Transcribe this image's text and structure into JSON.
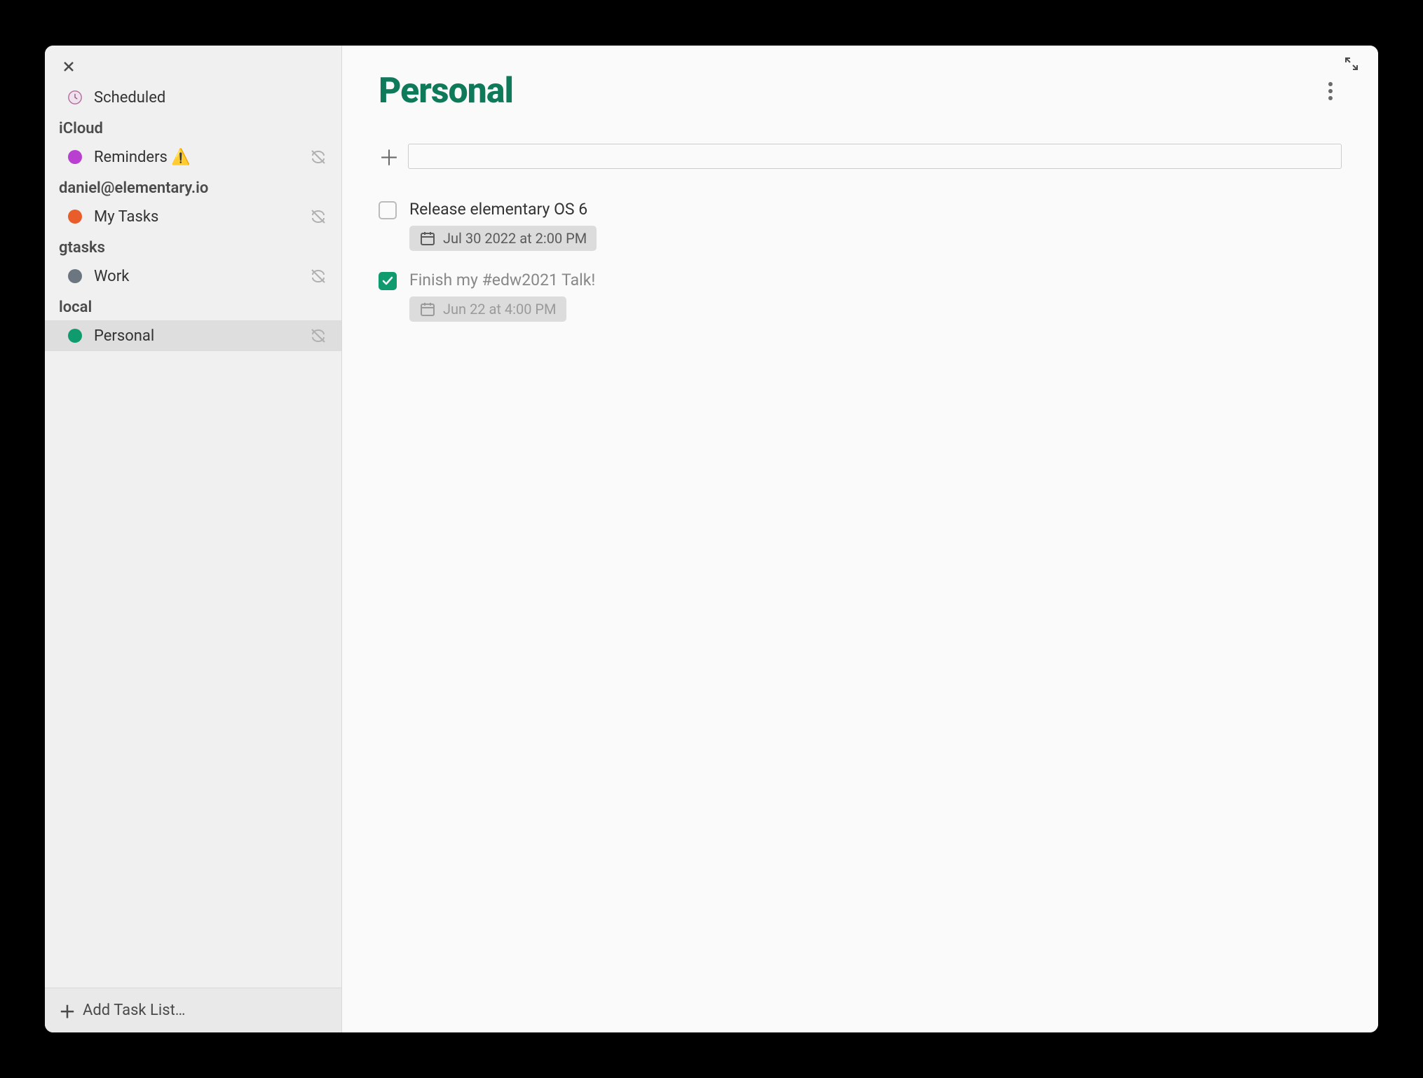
{
  "sidebar": {
    "scheduled_label": "Scheduled",
    "add_task_list_label": "Add Task List…",
    "sections": [
      {
        "name": "iCloud",
        "items": [
          {
            "id": "reminders",
            "label": "Reminders",
            "warning": "⚠️",
            "color": "#b93fd1",
            "has_sync_off": true,
            "selected": false
          }
        ]
      },
      {
        "name": "daniel@elementary.io",
        "items": [
          {
            "id": "my-tasks",
            "label": "My Tasks",
            "color": "#e85d2a",
            "has_sync_off": true,
            "selected": false
          }
        ]
      },
      {
        "name": "gtasks",
        "items": [
          {
            "id": "work",
            "label": "Work",
            "color": "#6b7680",
            "has_sync_off": true,
            "selected": false
          }
        ]
      },
      {
        "name": "local",
        "items": [
          {
            "id": "personal",
            "label": "Personal",
            "color": "#0f9b6e",
            "has_sync_off": true,
            "selected": true
          }
        ]
      }
    ]
  },
  "main": {
    "title": "Personal",
    "title_color": "#0f7a5a",
    "new_task_placeholder": "",
    "tasks": [
      {
        "id": "task1",
        "title": "Release elementary OS 6",
        "completed": false,
        "date": "Jul 30 2022 at 2:00 PM"
      },
      {
        "id": "task2",
        "title": "Finish my #edw2021 Talk!",
        "completed": true,
        "date": "Jun 22 at 4:00 PM"
      }
    ]
  }
}
